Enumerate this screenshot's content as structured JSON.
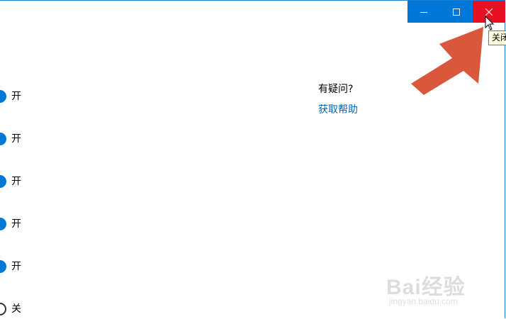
{
  "titlebar": {
    "minimize_icon": "minimize-icon",
    "maximize_icon": "maximize-icon",
    "close_icon": "close-icon",
    "accent": "#0078d7",
    "close_hover": "#e81123"
  },
  "tooltip": {
    "text": "关闭"
  },
  "toggles": [
    {
      "label": "开",
      "state": "on"
    },
    {
      "label": "开",
      "state": "on"
    },
    {
      "label": "开",
      "state": "on"
    },
    {
      "label": "开",
      "state": "on"
    },
    {
      "label": "开",
      "state": "on"
    },
    {
      "label": "关",
      "state": "off"
    }
  ],
  "help": {
    "title": "有疑问?",
    "link": "获取帮助",
    "link_color": "#0067b8"
  },
  "annotation": {
    "arrow_color": "#d9573a"
  },
  "watermark": {
    "brand": "Bai经验",
    "url": "jingyan.baidu.com"
  }
}
